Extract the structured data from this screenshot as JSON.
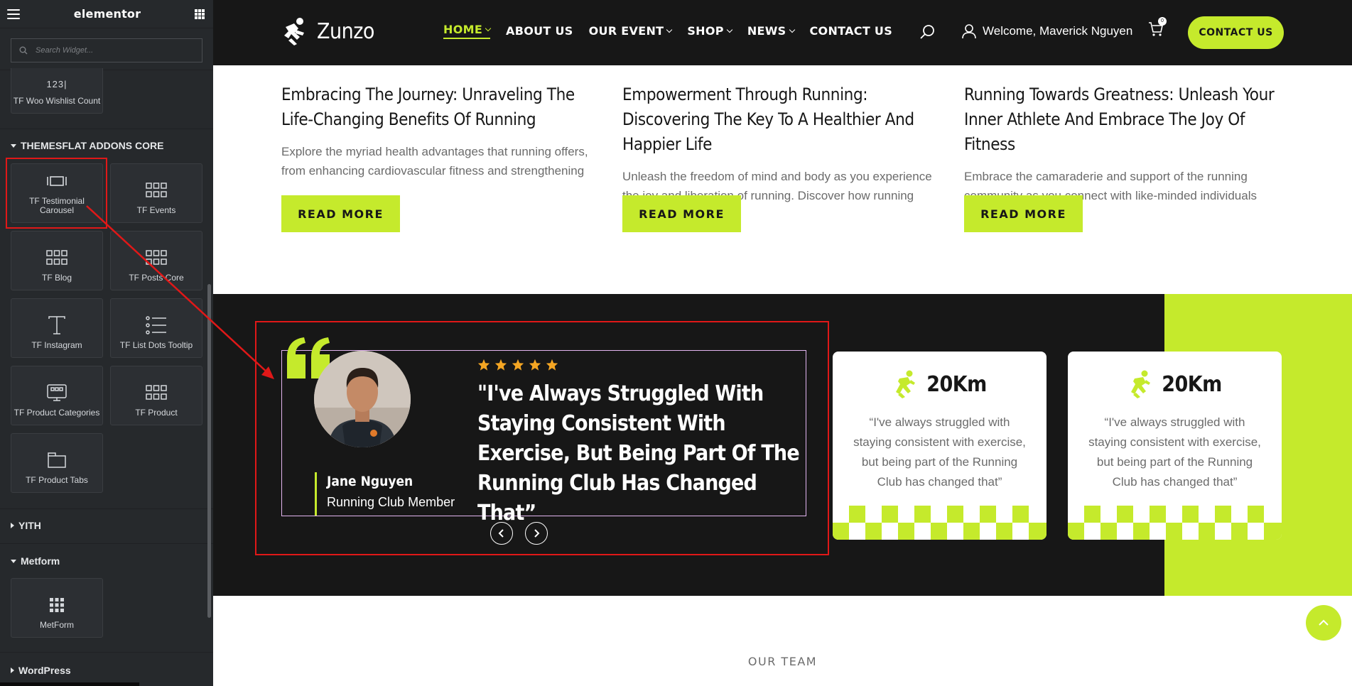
{
  "panel": {
    "logo": "elementor",
    "search_placeholder": "Search Widget...",
    "top_widget": {
      "label": "TF Woo Wishlist Count",
      "icon_text": "123|"
    },
    "sections": [
      {
        "title": "THEMESFLAT ADDONS CORE",
        "expanded": true
      },
      {
        "title": "YITH",
        "expanded": false
      },
      {
        "title": "Metform",
        "expanded": true
      },
      {
        "title": "WordPress",
        "expanded": false
      }
    ],
    "widgets": [
      {
        "label": "TF Testimonial Carousel",
        "icon": "carousel-icon",
        "highlighted": true
      },
      {
        "label": "TF Events",
        "icon": "grid-posts-icon"
      },
      {
        "label": "TF Blog",
        "icon": "grid-posts-icon"
      },
      {
        "label": "TF Posts Core",
        "icon": "grid-posts-icon"
      },
      {
        "label": "TF Instagram",
        "icon": "text-t-icon"
      },
      {
        "label": "TF List Dots Tooltip",
        "icon": "list-icon"
      },
      {
        "label": "TF Product Categories",
        "icon": "product-categories-icon"
      },
      {
        "label": "TF Product",
        "icon": "grid-posts-icon"
      },
      {
        "label": "TF Product Tabs",
        "icon": "tabs-icon"
      }
    ],
    "metform_widget": {
      "label": "MetForm",
      "icon": "grid-dots-icon"
    }
  },
  "site": {
    "brand": "Zunzo",
    "menu": [
      {
        "label": "HOME",
        "active": true,
        "dropdown": true
      },
      {
        "label": "ABOUT US",
        "active": false,
        "dropdown": false
      },
      {
        "label": "OUR EVENT",
        "active": false,
        "dropdown": true
      },
      {
        "label": "SHOP",
        "active": false,
        "dropdown": true
      },
      {
        "label": "NEWS",
        "active": false,
        "dropdown": true
      },
      {
        "label": "CONTACT US",
        "active": false,
        "dropdown": false
      }
    ],
    "welcome": "Welcome, Maverick Nguyen",
    "cart_count": "0",
    "contact_button": "CONTACT US",
    "posts": [
      {
        "title": "Embracing The Journey: Unraveling The Life-Changing Benefits Of Running",
        "excerpt": "Explore the myriad health advantages that running offers, from enhancing cardiovascular fitness and strengthening",
        "button": "READ MORE"
      },
      {
        "title": "Empowerment Through Running: Discovering The Key To A Healthier And Happier Life",
        "excerpt": "Unleash the freedom of mind and body as you experience the joy and liberation of running. Discover how running",
        "button": "READ MORE"
      },
      {
        "title": "Running Towards Greatness: Unleash Your Inner Athlete And Embrace The Joy Of Fitness",
        "excerpt": "Embrace the camaraderie and support of the running community as you connect with like-minded individuals",
        "button": "READ MORE"
      }
    ],
    "testimonial": {
      "rating": 5,
      "quote": "\"I've Always Struggled With Staying Consistent With Exercise, But Being Part Of The Running Club Has Changed That”",
      "author": "Jane Nguyen",
      "role": "Running Club Member"
    },
    "stats": [
      {
        "value": "20Km",
        "quote": "“I've always struggled with staying consistent with exercise, but being part of the Running Club has changed that”"
      },
      {
        "value": "20Km",
        "quote": "“I've always struggled with staying consistent with exercise, but being part of the Running Club has changed that”"
      }
    ],
    "team_label": "OUR TEAM"
  },
  "colors": {
    "accent": "#c5ea2c",
    "dark": "#171717",
    "highlight_red": "#e01818",
    "panel_bg": "#26292c"
  }
}
